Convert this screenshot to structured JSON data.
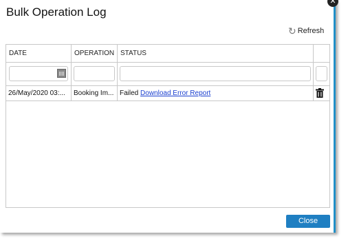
{
  "dialog": {
    "title": "Bulk Operation Log",
    "refresh_label": "Refresh",
    "close_label": "Close"
  },
  "grid": {
    "columns": [
      "DATE",
      "OPERATION",
      "STATUS"
    ],
    "rows": [
      {
        "date": "26/May/2020 03:...",
        "operation": "Booking Im...",
        "status": "Failed",
        "link": "Download Error Report"
      }
    ]
  }
}
